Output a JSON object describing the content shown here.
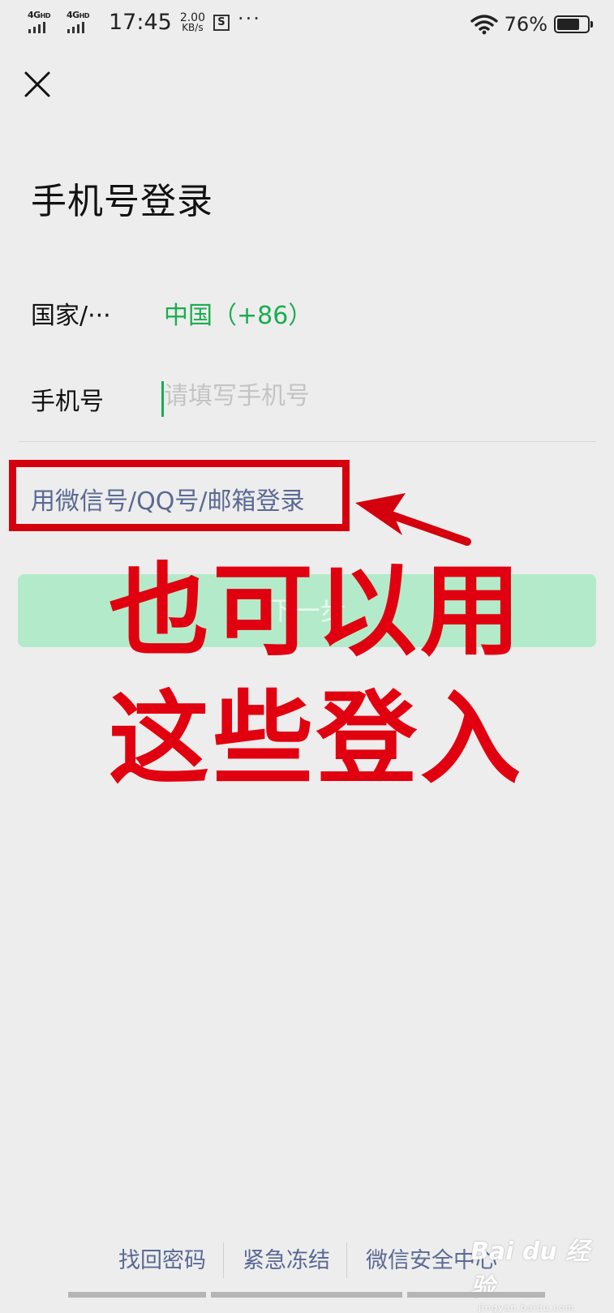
{
  "status_bar": {
    "network_1": "4G",
    "network_1_sup": "HD",
    "network_2": "4G",
    "network_2_sup": "HD",
    "time": "17:45",
    "speed_value": "2.00",
    "speed_unit": "KB/s",
    "more": "···",
    "battery_percent": "76%",
    "battery_level": 0.76
  },
  "header": {
    "close_icon": "close-icon"
  },
  "page": {
    "title": "手机号登录"
  },
  "form": {
    "country_label": "国家/···",
    "country_value": "中国（+86）",
    "phone_label": "手机号",
    "phone_placeholder": "请填写手机号",
    "phone_value": ""
  },
  "alt_login": {
    "label": "用微信号/QQ号/邮箱登录"
  },
  "next_button": {
    "label": "下一步"
  },
  "annotation": {
    "line1": "也可以用",
    "line2": "这些登入"
  },
  "footer": {
    "links": [
      "找回密码",
      "紧急冻结",
      "微信安全中心"
    ]
  },
  "watermark": {
    "main": "Bai du 经验",
    "sub": "jingyan.baidu.com"
  },
  "colors": {
    "accent_green": "#1aad50",
    "button_disabled": "#b3ebca",
    "link_blue": "#5b6a93",
    "annotation_red": "#e1000f",
    "background": "#ededed"
  }
}
